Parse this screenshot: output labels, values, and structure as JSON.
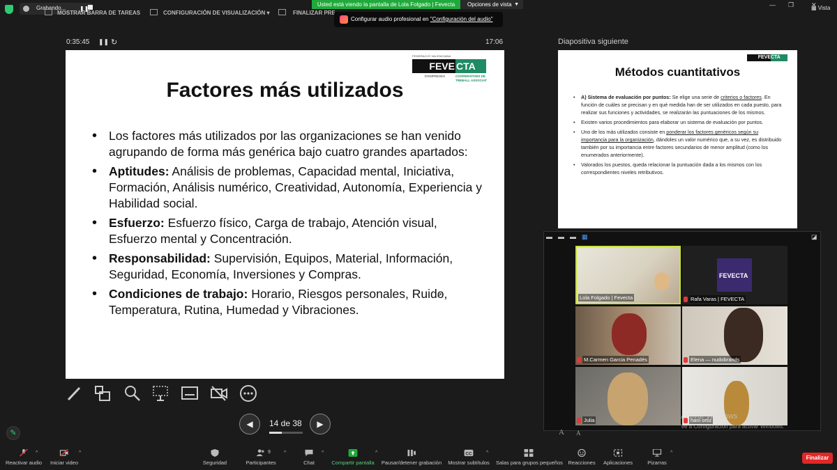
{
  "topbar": {
    "recording_label": "Grabando...",
    "items": [
      "MOSTRAR BARRA DE TAREAS",
      "CONFIGURACIÓN DE VISUALIZACIÓN ▾",
      "FINALIZAR PRESENTACIÓN"
    ],
    "share_banner": "Usted está viendo la pantalla de Lola Folgado | Fevecta",
    "view_options": "Opciones de vista",
    "vista": "Vista",
    "tooltip_text": "Configurar audio profesional en ",
    "tooltip_link": "\"Configuración del audio\""
  },
  "presenter": {
    "elapsed": "0:35:45",
    "clock": "17:06",
    "page": "14 de 38",
    "page_fraction": 0.368
  },
  "slide": {
    "logo_top": "FEDERACIÓ VALENCIANA",
    "logo_left": "FEVE",
    "logo_right": "CTA",
    "logo_sub1": "D'EMPRESES",
    "logo_sub2": "COOPERATIVES DE TREBALL ASSOCIAT",
    "title": "Factores más utilizados",
    "intro": "Los factores más utilizados por las organizaciones se han venido agrupando de forma más genérica bajo cuatro grandes apartados:",
    "groups": [
      {
        "label": "Aptitudes:",
        "text": " Análisis de problemas, Capacidad mental, Iniciativa, Formación, Análisis numérico, Creatividad, Autonomía, Experiencia y Habilidad social."
      },
      {
        "label": "Esfuerzo:",
        "text": " Esfuerzo físico, Carga de trabajo, Atención visual, Esfuerzo mental y Concentración."
      },
      {
        "label": "Responsabilidad:",
        "text": " Supervisión, Equipos, Material, Información, Seguridad, Economía, Inversiones y Compras."
      },
      {
        "label": "Condiciones de trabajo:",
        "text": " Horario, Riesgos personales, Ruido, Temperatura, Rutina, Humedad y Vibraciones."
      }
    ]
  },
  "next_slide": {
    "label": "Diapositiva siguiente",
    "logo_left": "FEVE",
    "logo_right": "CTA",
    "title": "Métodos cuantitativos",
    "b1_label": "A) Sistema de evaluación por puntos:",
    "b1_text_a": " Se elige una serie de ",
    "b1_link": "criterios o factores",
    "b1_text_b": ". En función de cuáles se precisan y en qué medida han de ser utilizados en cada puesto, para realizar sus funciones y actividades, se realizarán las puntuaciones de los mismos.",
    "b2": "Existen varios procedimientos para elaborar un sistema de evaluación por puntos.",
    "b3_a": "Uno de los más utilizados consiste en ",
    "b3_link": "ponderar los factores genéricos según su importancia para la organización",
    "b3_b": ", dándoles un valor numérico que, a su vez, es distribuido también por su importancia entre factores secundarios de menor amplitud (como los enumerados anteriormente).",
    "b4": "Valorados los puestos, queda relacionar la puntuación dada a los mismos con los correspondientes niveles retributivos."
  },
  "participants": [
    {
      "name": "Lola Folgado | Fevecta",
      "muted": false
    },
    {
      "name": "Rafa Varas | FEVECTA",
      "muted": true
    },
    {
      "name": "M.Carmen Garcia Penadés",
      "muted": true
    },
    {
      "name": "Elena — nudobrands",
      "muted": true
    },
    {
      "name": "Julia",
      "muted": true
    },
    {
      "name": "hani ortiz",
      "muted": true
    }
  ],
  "fevecta_badge": "FEVECTA",
  "watermark": "Activar Windows",
  "watermark_sub": "Ve a Configuración para activar Windows.",
  "toolbar": {
    "buttons": [
      "Reactivar audio",
      "Iniciar video",
      "Seguridad",
      "Participantes",
      "Chat",
      "Compartir pantalla",
      "Pausar/detener grabación",
      "Mostrar subtítulos",
      "Salas para grupos pequeños",
      "Reacciones",
      "Aplicaciones",
      "Pizarras"
    ],
    "participants_count": "9",
    "end": "Finalizar"
  },
  "colors": {
    "share_green": "#1faa3b",
    "end_red": "#e02828",
    "fevecta_green": "#1f8a63"
  }
}
